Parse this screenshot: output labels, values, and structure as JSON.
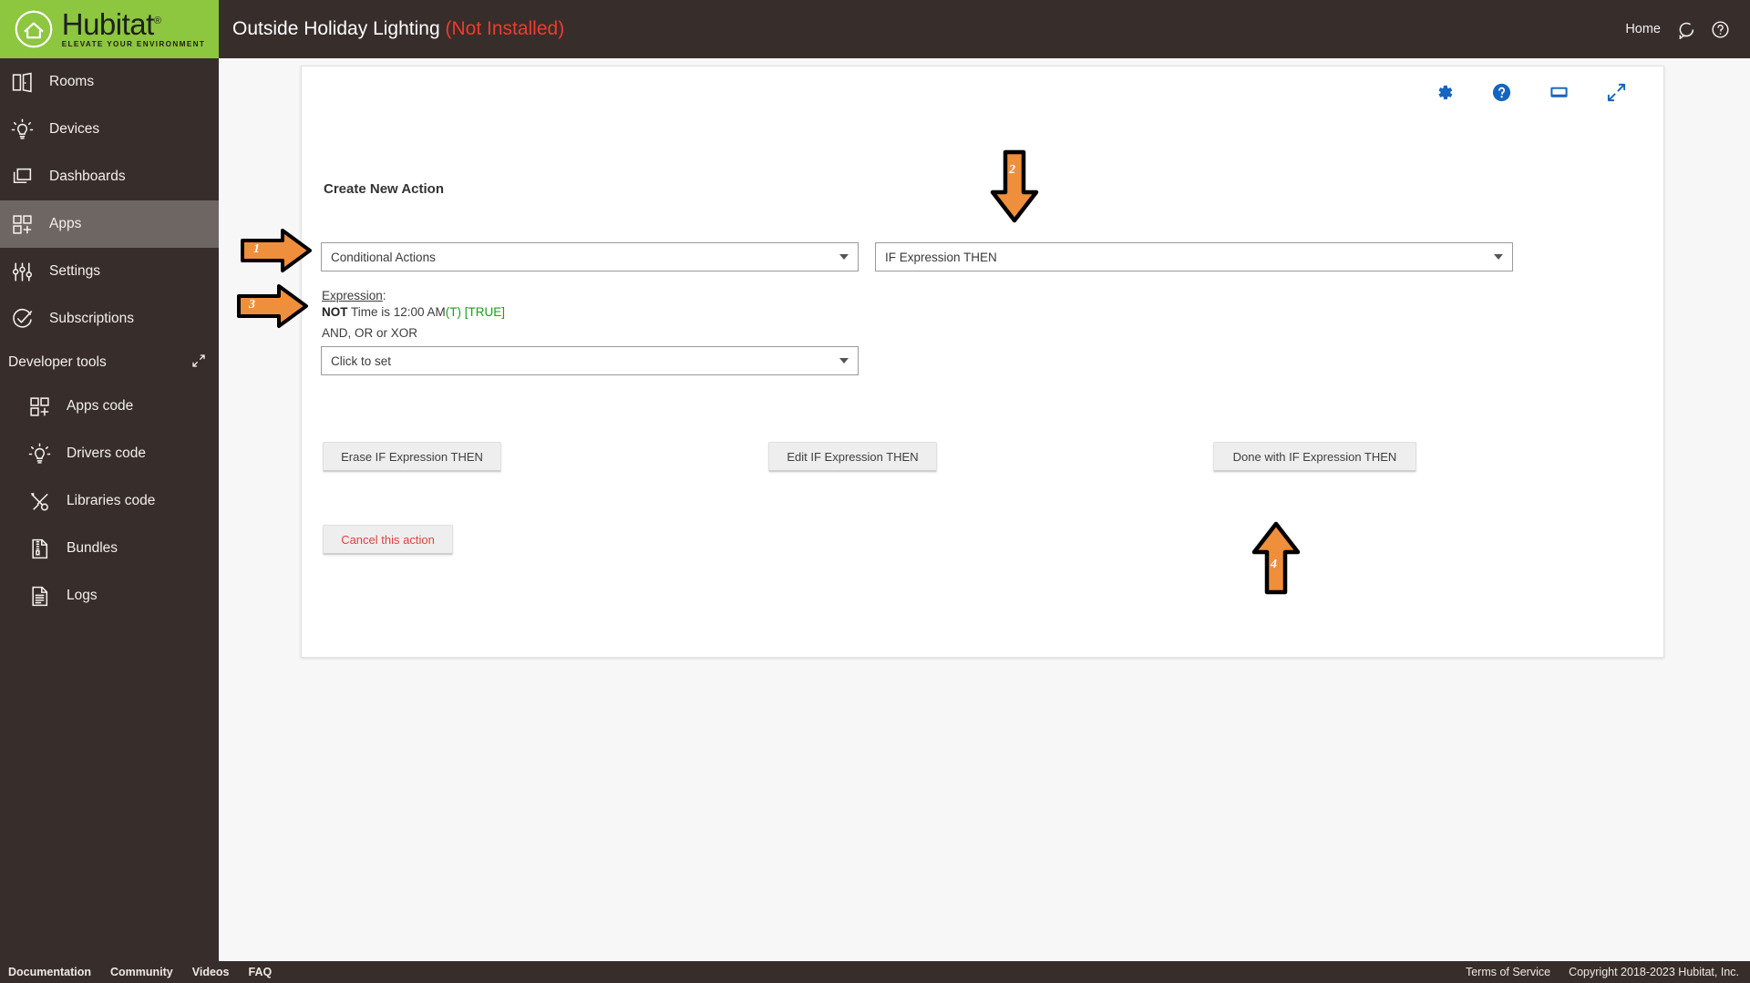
{
  "brand": {
    "name": "Hubitat",
    "trademark": "®",
    "tagline": "ELEVATE YOUR ENVIRONMENT",
    "green": "#8dc63f",
    "dark": "#372e2b"
  },
  "header": {
    "app_name": "Outside Holiday Lighting",
    "app_status": "(Not Installed)",
    "status_color": "#f03a2e",
    "home_label": "Home",
    "icons": [
      "chat-bubble-icon",
      "help-circle-icon"
    ]
  },
  "sidebar": {
    "items": [
      {
        "label": "Rooms",
        "icon": "rooms-icon",
        "active": false
      },
      {
        "label": "Devices",
        "icon": "devices-icon",
        "active": false
      },
      {
        "label": "Dashboards",
        "icon": "dashboards-icon",
        "active": false
      },
      {
        "label": "Apps",
        "icon": "apps-icon",
        "active": true
      },
      {
        "label": "Settings",
        "icon": "settings-icon",
        "active": false
      },
      {
        "label": "Subscriptions",
        "icon": "subscriptions-icon",
        "active": false
      }
    ],
    "section": {
      "label": "Developer tools",
      "collapse_icon": "collapse-icon"
    },
    "dev_items": [
      {
        "label": "Apps code",
        "icon": "apps-code-icon"
      },
      {
        "label": "Drivers code",
        "icon": "drivers-code-icon"
      },
      {
        "label": "Libraries code",
        "icon": "libraries-code-icon"
      },
      {
        "label": "Bundles",
        "icon": "bundles-icon"
      },
      {
        "label": "Logs",
        "icon": "logs-icon"
      }
    ]
  },
  "card": {
    "tools": [
      {
        "name": "gear-icon",
        "color": "#1565c0"
      },
      {
        "name": "help-circle-icon",
        "color": "#1565c0"
      },
      {
        "name": "display-icon",
        "color": "#1565c0"
      },
      {
        "name": "expand-icon",
        "color": "#1565c0"
      }
    ],
    "create_action_label": "Create New Action",
    "action_select": {
      "value": "Conditional Actions",
      "icon": "chevron-down-icon"
    },
    "if_select": {
      "value": "IF Expression THEN",
      "icon": "chevron-down-icon"
    },
    "expression": {
      "label": "Expression",
      "label_colon": ":",
      "not": "NOT",
      "text": " Time is 12:00 AM",
      "t_flag": "(T)",
      "truth": " [TRUE]",
      "truth_color": "#17a117"
    },
    "logic": {
      "label": "AND, OR or XOR",
      "value": "Click to set",
      "icon": "chevron-down-icon"
    },
    "buttons": {
      "erase": "Erase IF Expression THEN",
      "edit": "Edit IF Expression THEN",
      "done": "Done with IF Expression THEN",
      "cancel": "Cancel this action"
    }
  },
  "annotations": [
    {
      "number": "1",
      "direction": "right",
      "target": "action-select"
    },
    {
      "number": "2",
      "direction": "down",
      "target": "if-select"
    },
    {
      "number": "3",
      "direction": "right",
      "target": "expression-value"
    },
    {
      "number": "4",
      "direction": "up",
      "target": "done-button"
    }
  ],
  "footer": {
    "links": [
      "Documentation",
      "Community",
      "Videos",
      "FAQ"
    ],
    "terms": "Terms of Service",
    "copyright": "Copyright 2018-2023 Hubitat, Inc."
  }
}
